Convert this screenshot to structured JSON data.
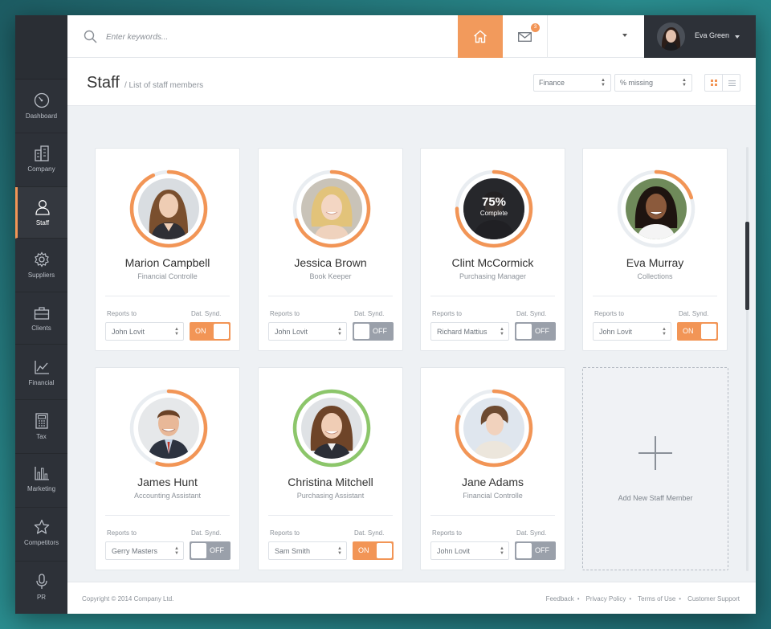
{
  "search": {
    "placeholder": "Enter keywords..."
  },
  "topbar": {
    "mail_badge": "3",
    "user_name": "Eva Green",
    "dropdown_value": ""
  },
  "sidebar": {
    "items": [
      {
        "label": "Dashboard",
        "icon": "gauge-icon"
      },
      {
        "label": "Company",
        "icon": "building-icon"
      },
      {
        "label": "Staff",
        "icon": "user-icon",
        "active": true
      },
      {
        "label": "Suppliers",
        "icon": "gear-icon"
      },
      {
        "label": "Clients",
        "icon": "briefcase-icon"
      },
      {
        "label": "Financial",
        "icon": "line-chart-icon"
      },
      {
        "label": "Tax",
        "icon": "calculator-icon"
      },
      {
        "label": "Marketing",
        "icon": "bar-chart-icon"
      },
      {
        "label": "Competitors",
        "icon": "star-icon"
      },
      {
        "label": "PR",
        "icon": "microphone-icon"
      }
    ]
  },
  "header": {
    "title": "Staff",
    "subtitle": "/ List of staff members",
    "filter_department": "Finance",
    "filter_sort": "% missing"
  },
  "labels": {
    "reports_to": "Reports to",
    "dat_synd": "Dat. Synd."
  },
  "colors": {
    "accent": "#f29556",
    "ring_green": "#8cc66a",
    "ring_track": "#e9edf1",
    "sidebar": "#2d3138"
  },
  "staff": [
    {
      "name": "Marion Campbell",
      "role": "Financial Controlle",
      "reports_to": "John Lovit",
      "sync": "ON",
      "progress": 0.93,
      "ring": "orange"
    },
    {
      "name": "Jessica Brown",
      "role": "Book Keeper",
      "reports_to": "John Lovit",
      "sync": "OFF",
      "progress": 0.7,
      "ring": "orange"
    },
    {
      "name": "Clint McCormick",
      "role": "Purchasing Manager",
      "reports_to": "Richard Mattius",
      "sync": "OFF",
      "progress": 0.75,
      "ring": "orange",
      "complete_pct": "75%",
      "complete_label": "Complete"
    },
    {
      "name": "Eva Murray",
      "role": "Collections",
      "reports_to": "John Lovit",
      "sync": "ON",
      "progress": 0.2,
      "ring": "orange"
    },
    {
      "name": "James Hunt",
      "role": "Accounting Assistant",
      "reports_to": "Gerry Masters",
      "sync": "OFF",
      "progress": 0.55,
      "ring": "orange"
    },
    {
      "name": "Christina Mitchell",
      "role": "Purchasing Assistant",
      "reports_to": "Sam Smith",
      "sync": "ON",
      "progress": 1.0,
      "ring": "green"
    },
    {
      "name": "Jane Adams",
      "role": "Financial Controlle",
      "reports_to": "John Lovit",
      "sync": "OFF",
      "progress": 0.8,
      "ring": "orange"
    }
  ],
  "add_card": {
    "label": "Add New Staff Member"
  },
  "footer": {
    "copyright": "Copyright © 2014 Company Ltd.",
    "links": [
      "Feedback",
      "Privacy Policy",
      "Terms of Use",
      "Customer Support"
    ]
  }
}
